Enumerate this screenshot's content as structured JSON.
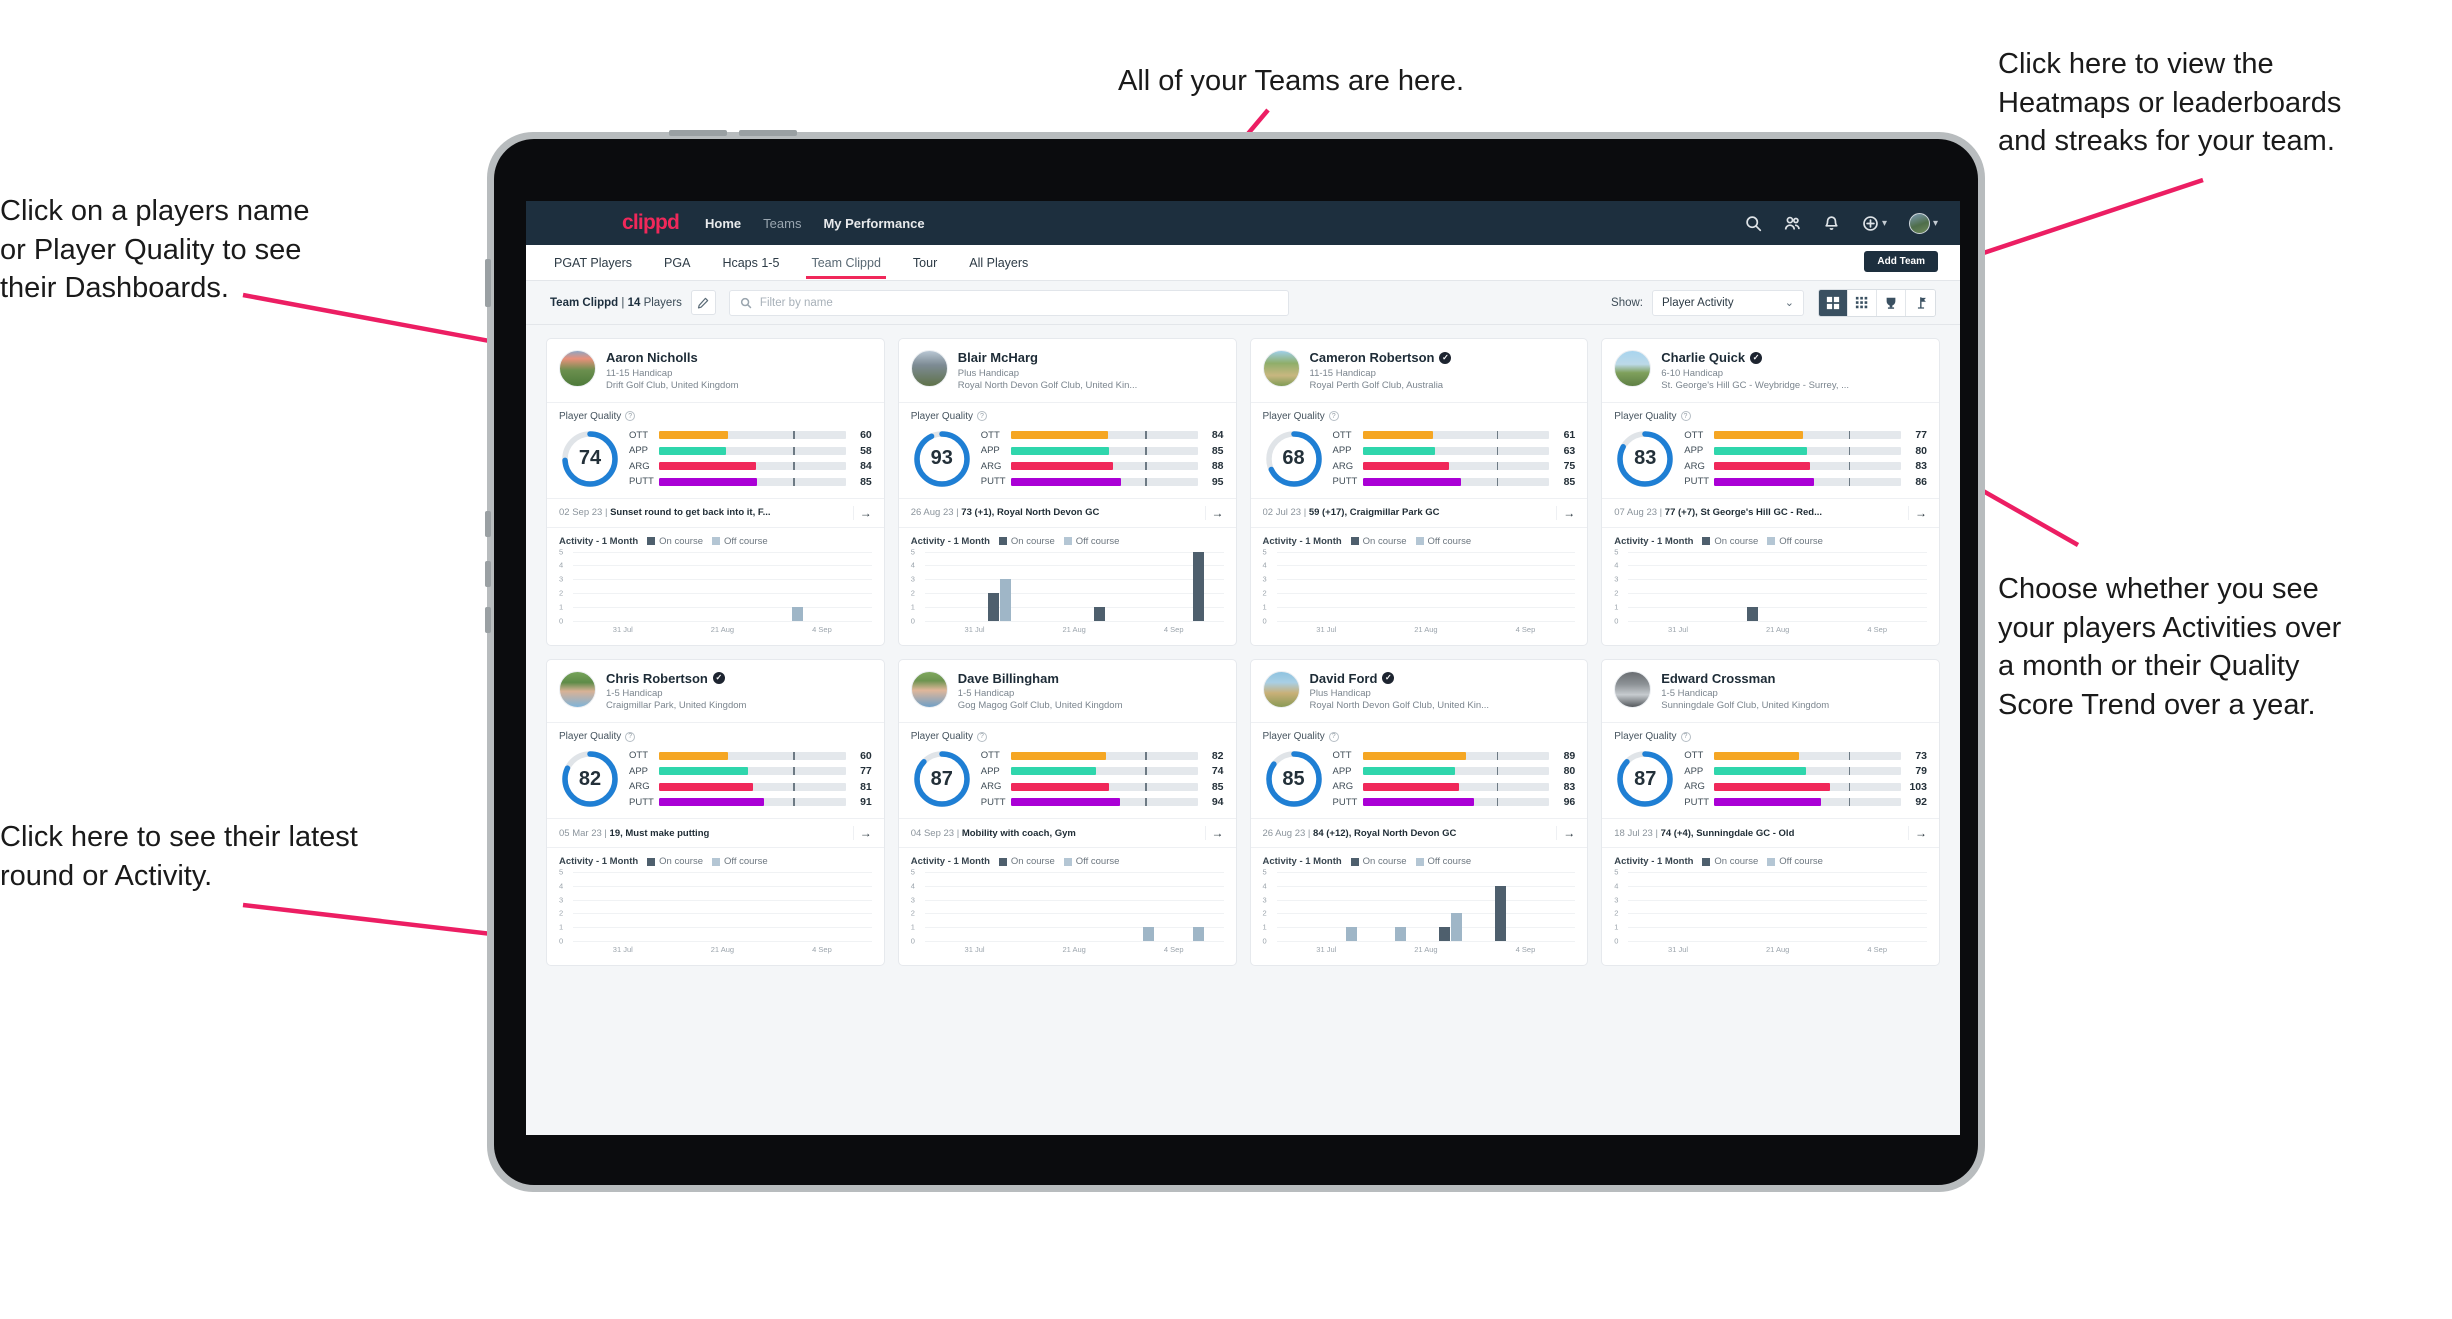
{
  "annotations": [
    {
      "id": "teams",
      "text": "All of your Teams are here."
    },
    {
      "id": "heatmaps",
      "text": "Click here to view the\nHeatmaps or leaderboards\nand streaks for your team."
    },
    {
      "id": "player-name",
      "text": "Click on a players name\nor Player Quality to see\ntheir Dashboards."
    },
    {
      "id": "show-mode",
      "text": "Choose whether you see\nyour players Activities over\na month or their Quality\nScore Trend over a year."
    },
    {
      "id": "latest-round",
      "text": "Click here to see their latest\nround or Activity."
    }
  ],
  "nav": {
    "logo": "clippd",
    "links": [
      {
        "label": "Home",
        "active": true
      },
      {
        "label": "Teams",
        "active": false
      },
      {
        "label": "My Performance",
        "active": true
      }
    ],
    "icons": [
      "search-icon",
      "people-icon",
      "bell-icon",
      "plus-circle-icon",
      "avatar-icon"
    ]
  },
  "tabs": [
    {
      "label": "PGAT Players",
      "active": false
    },
    {
      "label": "PGA",
      "active": false
    },
    {
      "label": "Hcaps 1-5",
      "active": false
    },
    {
      "label": "Team Clippd",
      "active": true
    },
    {
      "label": "Tour",
      "active": false
    },
    {
      "label": "All Players",
      "active": false
    }
  ],
  "add_team_button": "Add Team",
  "filterbar": {
    "team_name": "Team Clippd",
    "separator": "|",
    "player_count": "14",
    "players_word": "Players",
    "edit_icon": "pencil-icon",
    "search_placeholder": "Filter by name",
    "show_label": "Show:",
    "show_value": "Player Activity",
    "view_buttons": [
      {
        "name": "grid-view",
        "icon": "grid-icon",
        "active": true
      },
      {
        "name": "heatmap-view",
        "icon": "dots-grid-icon",
        "active": false
      },
      {
        "name": "leaderboard-view",
        "icon": "trophy-icon",
        "active": false
      },
      {
        "name": "streaks-view",
        "icon": "flag-icon",
        "active": false
      }
    ]
  },
  "card_labels": {
    "player_quality": "Player Quality",
    "help_icon": "question-mark-icon",
    "activity_title": "Activity - 1 Month",
    "legend_on": "On course",
    "legend_off": "Off course",
    "go_arrow": "→"
  },
  "metric_colors": {
    "OTT": "#f5a623",
    "APP": "#2fd6ac",
    "ARG": "#f0285a",
    "PUTT": "#aa00d6",
    "gauge": "#1f7fd4",
    "gauge_track": "#e0e4e8"
  },
  "chart_data": {
    "type": "bar",
    "title": "Activity - 1 Month",
    "xlabel": "",
    "ylabel": "",
    "ylim": [
      0,
      5
    ],
    "yticks": [
      5,
      4,
      3,
      2,
      1,
      0
    ],
    "tick_labels": [
      "31 Jul",
      "21 Aug",
      "4 Sep"
    ],
    "grid": true,
    "legend": [
      "On course",
      "Off course"
    ],
    "legend_position": "top",
    "series_colors": {
      "On course": "#4e5f6d",
      "Off course": "#9fb6c7"
    }
  },
  "players": [
    {
      "name": "Aaron Nicholls",
      "verified": false,
      "handicap": "11-15 Handicap",
      "club": "Drift Golf Club, United Kingdom",
      "quality": 74,
      "metrics": [
        {
          "label": "OTT",
          "value": 60
        },
        {
          "label": "APP",
          "value": 58
        },
        {
          "label": "ARG",
          "value": 84
        },
        {
          "label": "PUTT",
          "value": 85
        }
      ],
      "round_date": "02 Sep 23",
      "round_text": "Sunset round to get back into it, F...",
      "avatar_style": "linear-gradient(180deg,#8fa5c2 0%,#e8907a 22%,#6b8f4e 55%,#4d7a3a 100%)",
      "activity": [
        {
          "on": 0,
          "off": 0
        },
        {
          "on": 0,
          "off": 0
        },
        {
          "on": 0,
          "off": 0
        },
        {
          "on": 0,
          "off": 0
        },
        {
          "on": 0,
          "off": 1
        },
        {
          "on": 0,
          "off": 0
        }
      ]
    },
    {
      "name": "Blair McHarg",
      "verified": false,
      "handicap": "Plus Handicap",
      "club": "Royal North Devon Golf Club, United Kin...",
      "quality": 93,
      "metrics": [
        {
          "label": "OTT",
          "value": 84
        },
        {
          "label": "APP",
          "value": 85
        },
        {
          "label": "ARG",
          "value": 88
        },
        {
          "label": "PUTT",
          "value": 95
        }
      ],
      "round_date": "26 Aug 23",
      "round_text": "73 (+1), Royal North Devon GC",
      "avatar_style": "linear-gradient(180deg,#b9c7d4 0%,#7d8b94 40%,#5f7249 100%)",
      "activity": [
        {
          "on": 0,
          "off": 0
        },
        {
          "on": 2,
          "off": 3
        },
        {
          "on": 0,
          "off": 0
        },
        {
          "on": 1,
          "off": 0
        },
        {
          "on": 0,
          "off": 0
        },
        {
          "on": 5,
          "off": 0
        }
      ]
    },
    {
      "name": "Cameron Robertson",
      "verified": true,
      "handicap": "11-15 Handicap",
      "club": "Royal Perth Golf Club, Australia",
      "quality": 68,
      "metrics": [
        {
          "label": "OTT",
          "value": 61
        },
        {
          "label": "APP",
          "value": 63
        },
        {
          "label": "ARG",
          "value": 75
        },
        {
          "label": "PUTT",
          "value": 85
        }
      ],
      "round_date": "02 Jul 23",
      "round_text": "59 (+17), Craigmillar Park GC",
      "avatar_style": "linear-gradient(180deg,#9fcfe8 0%,#8fae6a 35%,#c8b780 70%,#7f9b55 100%)",
      "activity": [
        {
          "on": 0,
          "off": 0
        },
        {
          "on": 0,
          "off": 0
        },
        {
          "on": 0,
          "off": 0
        },
        {
          "on": 0,
          "off": 0
        },
        {
          "on": 0,
          "off": 0
        },
        {
          "on": 0,
          "off": 0
        }
      ]
    },
    {
      "name": "Charlie Quick",
      "verified": true,
      "handicap": "6-10 Handicap",
      "club": "St. George's Hill GC - Weybridge - Surrey, ...",
      "quality": 83,
      "metrics": [
        {
          "label": "OTT",
          "value": 77
        },
        {
          "label": "APP",
          "value": 80
        },
        {
          "label": "ARG",
          "value": 83
        },
        {
          "label": "PUTT",
          "value": 86
        }
      ],
      "round_date": "07 Aug 23",
      "round_text": "77 (+7), St George's Hill GC - Red...",
      "avatar_style": "linear-gradient(180deg,#a8d4ee 0%,#bcd9e8 38%,#7fa05c 62%,#5e7f44 100%)",
      "activity": [
        {
          "on": 0,
          "off": 0
        },
        {
          "on": 0,
          "off": 0
        },
        {
          "on": 1,
          "off": 0
        },
        {
          "on": 0,
          "off": 0
        },
        {
          "on": 0,
          "off": 0
        },
        {
          "on": 0,
          "off": 0
        }
      ]
    },
    {
      "name": "Chris Robertson",
      "verified": true,
      "handicap": "1-5 Handicap",
      "club": "Craigmillar Park, United Kingdom",
      "quality": 82,
      "metrics": [
        {
          "label": "OTT",
          "value": 60
        },
        {
          "label": "APP",
          "value": 77
        },
        {
          "label": "ARG",
          "value": 81
        },
        {
          "label": "PUTT",
          "value": 91
        }
      ],
      "round_date": "05 Mar 23",
      "round_text": "19, Must make putting",
      "avatar_style": "linear-gradient(180deg,#76a35a 0%,#5e8b48 30%,#d8b296 55%,#7fb3d8 100%)",
      "activity": [
        {
          "on": 0,
          "off": 0
        },
        {
          "on": 0,
          "off": 0
        },
        {
          "on": 0,
          "off": 0
        },
        {
          "on": 0,
          "off": 0
        },
        {
          "on": 0,
          "off": 0
        },
        {
          "on": 0,
          "off": 0
        }
      ]
    },
    {
      "name": "Dave Billingham",
      "verified": false,
      "handicap": "1-5 Handicap",
      "club": "Gog Magog Golf Club, United Kingdom",
      "quality": 87,
      "metrics": [
        {
          "label": "OTT",
          "value": 82
        },
        {
          "label": "APP",
          "value": 74
        },
        {
          "label": "ARG",
          "value": 85
        },
        {
          "label": "PUTT",
          "value": 94
        }
      ],
      "round_date": "04 Sep 23",
      "round_text": "Mobility with coach, Gym",
      "avatar_style": "linear-gradient(180deg,#7fa85e 0%,#6e9450 25%,#e0b79a 52%,#6f9fc6 100%)",
      "activity": [
        {
          "on": 0,
          "off": 0
        },
        {
          "on": 0,
          "off": 0
        },
        {
          "on": 0,
          "off": 0
        },
        {
          "on": 0,
          "off": 0
        },
        {
          "on": 0,
          "off": 1
        },
        {
          "on": 0,
          "off": 1
        }
      ]
    },
    {
      "name": "David Ford",
      "verified": true,
      "handicap": "Plus Handicap",
      "club": "Royal North Devon Golf Club, United Kin...",
      "quality": 85,
      "metrics": [
        {
          "label": "OTT",
          "value": 89
        },
        {
          "label": "APP",
          "value": 80
        },
        {
          "label": "ARG",
          "value": 83
        },
        {
          "label": "PUTT",
          "value": 96
        }
      ],
      "round_date": "26 Aug 23",
      "round_text": "84 (+12), Royal North Devon GC",
      "avatar_style": "linear-gradient(180deg,#8fc3e0 0%,#a9cfe4 30%,#c9b078 60%,#8a9a55 100%)",
      "activity": [
        {
          "on": 0,
          "off": 0
        },
        {
          "on": 0,
          "off": 1
        },
        {
          "on": 0,
          "off": 1
        },
        {
          "on": 1,
          "off": 2
        },
        {
          "on": 4,
          "off": 0
        },
        {
          "on": 0,
          "off": 0
        }
      ]
    },
    {
      "name": "Edward Crossman",
      "verified": false,
      "handicap": "1-5 Handicap",
      "club": "Sunningdale Golf Club, United Kingdom",
      "quality": 87,
      "metrics": [
        {
          "label": "OTT",
          "value": 73
        },
        {
          "label": "APP",
          "value": 79
        },
        {
          "label": "ARG",
          "value": 103
        },
        {
          "label": "PUTT",
          "value": 92
        }
      ],
      "round_date": "18 Jul 23",
      "round_text": "74 (+4), Sunningdale GC - Old",
      "avatar_style": "linear-gradient(180deg,#6a6e72 0%,#8d9296 35%,#c6cbcf 65%,#55595d 100%)",
      "activity": [
        {
          "on": 0,
          "off": 0
        },
        {
          "on": 0,
          "off": 0
        },
        {
          "on": 0,
          "off": 0
        },
        {
          "on": 0,
          "off": 0
        },
        {
          "on": 0,
          "off": 0
        },
        {
          "on": 0,
          "off": 0
        }
      ]
    }
  ]
}
